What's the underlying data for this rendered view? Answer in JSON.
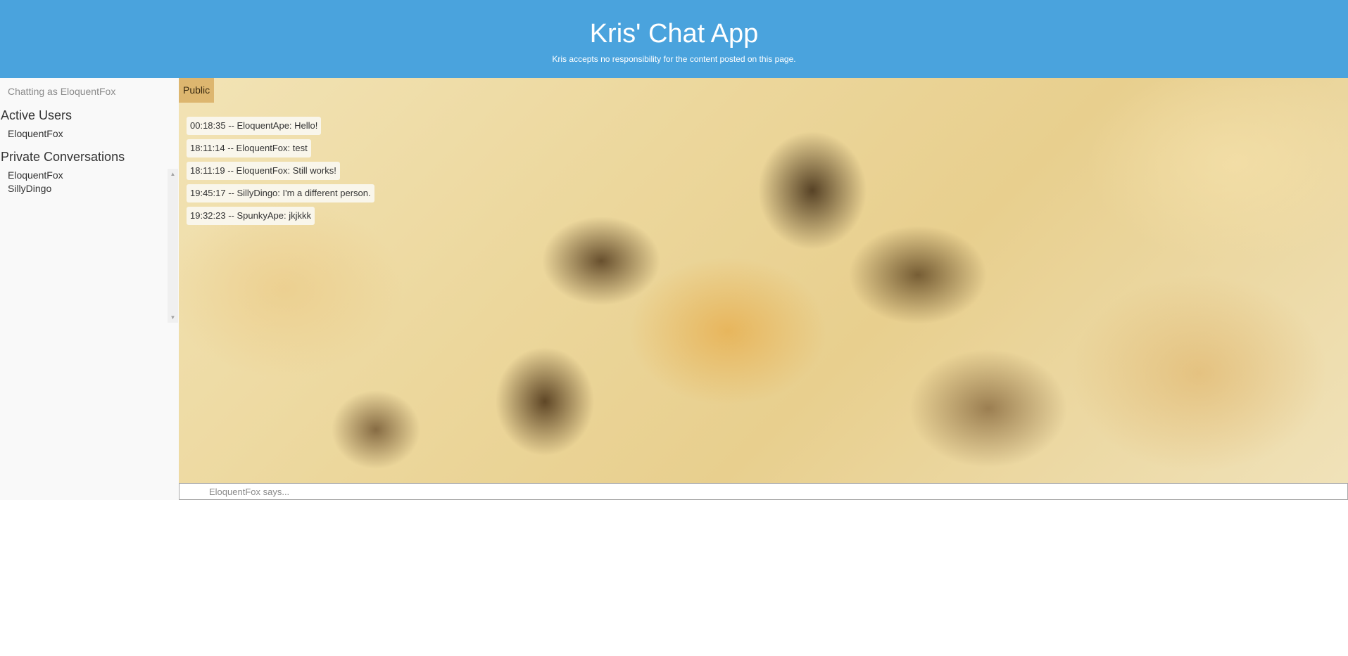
{
  "header": {
    "title": "Kris' Chat App",
    "subtitle": "Kris accepts no responsibility for the content posted on this page."
  },
  "sidebar": {
    "chatting_as": "Chatting as EloquentFox",
    "active_users_heading": "Active Users",
    "active_users": [
      "EloquentFox"
    ],
    "private_conversations_heading": "Private Conversations",
    "private_conversations": [
      "EloquentFox",
      "SillyDingo"
    ]
  },
  "chat": {
    "active_tab": "Public",
    "messages": [
      "00:18:35 -- EloquentApe: Hello!",
      "18:11:14 -- EloquentFox: test",
      "18:11:19 -- EloquentFox: Still works!",
      "19:45:17 -- SillyDingo: I'm a different person.",
      "19:32:23 -- SpunkyApe: jkjkkk"
    ],
    "input_placeholder": "EloquentFox says..."
  },
  "colors": {
    "header_bg": "#4aa3dd",
    "sidebar_bg": "#f9f9f9",
    "tab_bg": "#ddb66f"
  },
  "icons": {
    "scroll_up": "triangle-up-icon",
    "scroll_down": "triangle-down-icon"
  }
}
